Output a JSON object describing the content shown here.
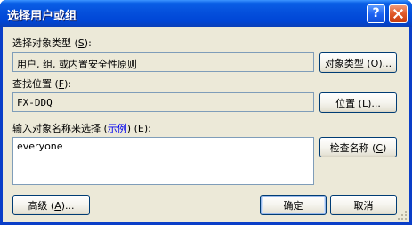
{
  "window": {
    "title": "选择用户或组"
  },
  "titlebar_buttons": {
    "help_label": "?"
  },
  "object_type": {
    "label_prefix": "选择对象类型 (",
    "label_key": "S",
    "label_suffix": "):",
    "value": "用户, 组, 或内置安全性原则",
    "button_prefix": "对象类型 (",
    "button_key": "O",
    "button_suffix": ")..."
  },
  "location": {
    "label_prefix": "查找位置 (",
    "label_key": "F",
    "label_suffix": "):",
    "value": "FX-DDQ",
    "button_prefix": "位置 (",
    "button_key": "L",
    "button_suffix": ")..."
  },
  "names": {
    "label_prefix": "输入对象名称来选择 (",
    "label_link": "示例",
    "label_mid": ") (",
    "label_key": "E",
    "label_suffix": "):",
    "value": "everyone",
    "check_button_prefix": "检查名称 (",
    "check_button_key": "C",
    "check_button_suffix": ")"
  },
  "footer": {
    "advanced_prefix": "高级 (",
    "advanced_key": "A",
    "advanced_suffix": ")...",
    "ok_label": "确定",
    "cancel_label": "取消"
  },
  "colors": {
    "titlebar": "#0550dc",
    "dialog_face": "#ece9d8",
    "close_button": "#e05a2a",
    "field_border": "#7f9db9",
    "button_border": "#003c74"
  },
  "icons": [
    "help-icon",
    "close-icon",
    "resize-grip-icon"
  ]
}
